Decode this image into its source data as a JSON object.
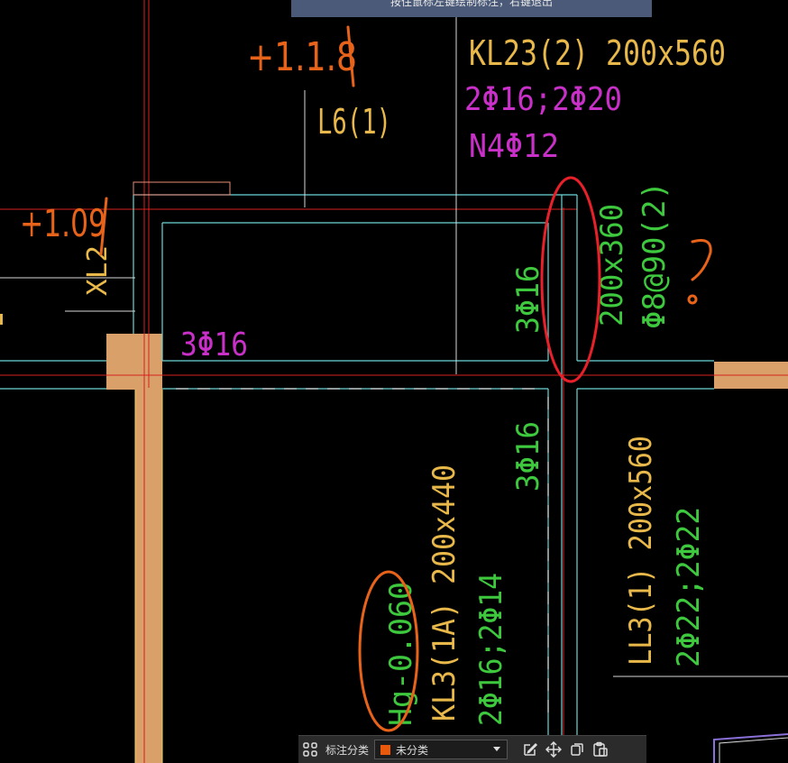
{
  "hint": "按住鼠标左键绘制标注，右键退出",
  "drawing": {
    "kl23_name": "KL23(2) 200x560",
    "kl23_rebar": "2Φ16;2Φ20",
    "kl23_side": "N4Φ12",
    "l6_name": "L6(1)",
    "xl2_name": "XL2",
    "bottom_left_rebar": "3Φ16",
    "vertical_rebar_top": "3Φ16",
    "vertical_section": "200x360",
    "vertical_stirrup": "Φ8@90(2)",
    "vertical_rebar_lower": "3Φ16",
    "kl3_name": "KL3(1A) 200x440",
    "kl3_elevation": "Hg-0.060",
    "kl3_rebar": "2Φ16;2Φ14",
    "ll3_name": "LL3(1) 200x560",
    "ll3_rebar": "2Φ22;2Φ22"
  },
  "annotations": {
    "markup_top": "+1.1.8",
    "markup_left": "+1.09",
    "question": "?"
  },
  "toolbar": {
    "category_label": "标注分类",
    "category_value": "未分类",
    "category_color": "#e8590c"
  },
  "colors": {
    "yellow": "#e8b84a",
    "magenta": "#c830c8",
    "green": "#3ec83e",
    "cyan": "#6ed6d6",
    "red": "#d82020",
    "white": "#d8d8d8",
    "orange": "#e8631a",
    "wall": "#d9a06a"
  }
}
